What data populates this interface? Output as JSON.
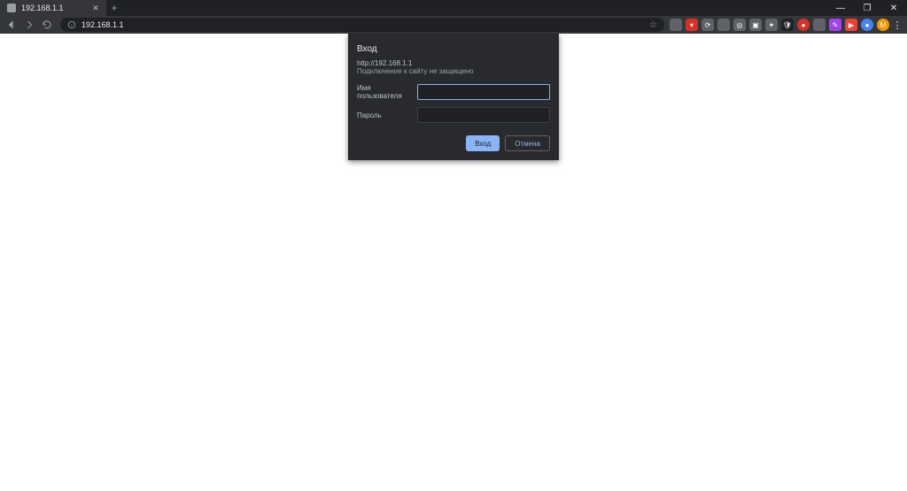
{
  "window": {
    "minimize": "—",
    "maximize": "❐",
    "close": "✕"
  },
  "tab": {
    "title": "192.168.1.1",
    "close": "✕"
  },
  "newtab": "+",
  "toolbar": {
    "url": "192.168.1.1"
  },
  "extensions": [
    {
      "name": "ext-1",
      "color": "#5f6368",
      "glyph": ""
    },
    {
      "name": "ext-2",
      "color": "#d93025",
      "glyph": "▾"
    },
    {
      "name": "ext-3",
      "color": "#5f6368",
      "glyph": "⟳"
    },
    {
      "name": "ext-4",
      "color": "#5f6368",
      "glyph": ""
    },
    {
      "name": "ext-5",
      "color": "#5f6368",
      "glyph": "◎"
    },
    {
      "name": "ext-6",
      "color": "#5f6368",
      "glyph": "▣"
    },
    {
      "name": "ext-7",
      "color": "#5f6368",
      "glyph": "✦"
    },
    {
      "name": "ext-8",
      "color": "#202124",
      "glyph": "🛡"
    },
    {
      "name": "ext-9",
      "color": "#d93025",
      "glyph": "●"
    },
    {
      "name": "ext-10",
      "color": "#5f6368",
      "glyph": ""
    },
    {
      "name": "ext-11",
      "color": "#a142f4",
      "glyph": "✎"
    },
    {
      "name": "ext-12",
      "color": "#ea4335",
      "glyph": "▶"
    },
    {
      "name": "ext-13",
      "color": "#4285f4",
      "glyph": "●"
    }
  ],
  "avatar": {
    "initial": "M"
  },
  "kebab": "⋮",
  "dialog": {
    "title": "Вход",
    "origin": "http://192.168.1.1",
    "warning": "Подключение к сайту не защищено",
    "username_label": "Имя пользователя",
    "password_label": "Пароль",
    "username_value": "",
    "password_value": "",
    "login_btn": "Вход",
    "cancel_btn": "Отмена"
  }
}
